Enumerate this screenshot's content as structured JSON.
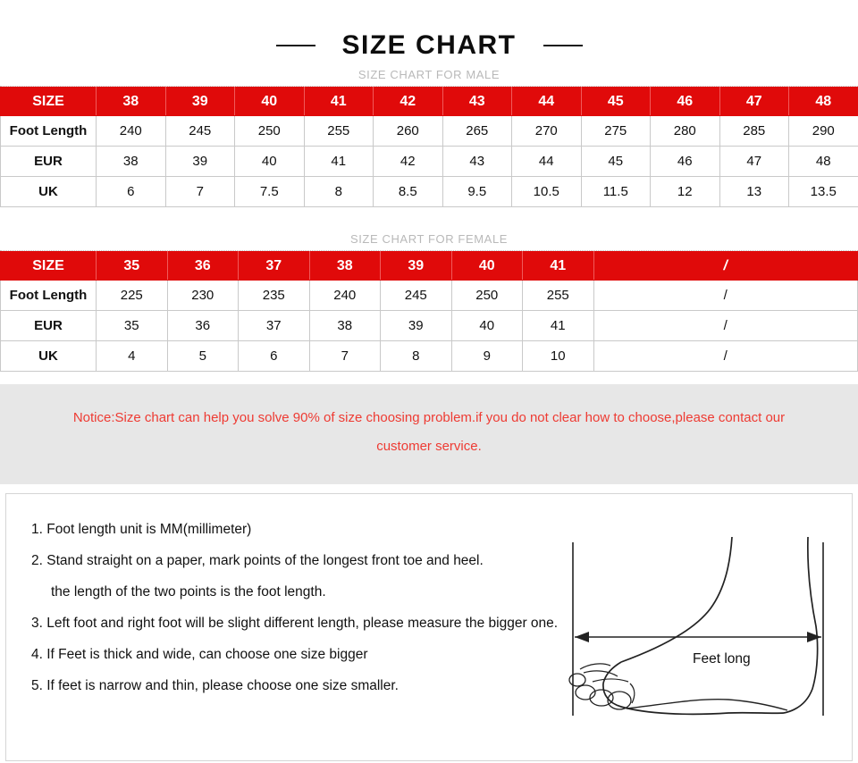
{
  "header": {
    "title": "SIZE CHART",
    "left_dash": "dash",
    "right_dash": "dash"
  },
  "male_section": {
    "caption": "SIZE CHART FOR MALE",
    "row_labels": [
      "SIZE",
      "Foot Length",
      "EUR",
      "UK"
    ],
    "sizes": [
      "38",
      "39",
      "40",
      "41",
      "42",
      "43",
      "44",
      "45",
      "46",
      "47",
      "48"
    ],
    "foot_length": [
      "240",
      "245",
      "250",
      "255",
      "260",
      "265",
      "270",
      "275",
      "280",
      "285",
      "290"
    ],
    "eur": [
      "38",
      "39",
      "40",
      "41",
      "42",
      "43",
      "44",
      "45",
      "46",
      "47",
      "48"
    ],
    "uk": [
      "6",
      "7",
      "7.5",
      "8",
      "8.5",
      "9.5",
      "10.5",
      "11.5",
      "12",
      "13",
      "13.5"
    ]
  },
  "female_section": {
    "caption": "SIZE CHART FOR FEMALE",
    "row_labels": [
      "SIZE",
      "Foot Length",
      "EUR",
      "UK"
    ],
    "sizes": [
      "35",
      "36",
      "37",
      "38",
      "39",
      "40",
      "41"
    ],
    "foot_length": [
      "225",
      "230",
      "235",
      "240",
      "245",
      "250",
      "255"
    ],
    "eur": [
      "35",
      "36",
      "37",
      "38",
      "39",
      "40",
      "41"
    ],
    "uk": [
      "4",
      "5",
      "6",
      "7",
      "8",
      "9",
      "10"
    ],
    "empty_marker": "/"
  },
  "notice": {
    "line1": "Notice:Size chart can help you solve 90% of size choosing problem.if you do not clear how to choose,please contact our",
    "line2": "customer service."
  },
  "instructions": {
    "steps": [
      "1. Foot length unit is MM(millimeter)",
      "2. Stand straight on a paper, mark points of the longest front toe and heel.",
      "the length of the two points is the foot length.",
      "3. Left foot and right foot will be slight different length, please measure the bigger one.",
      "4. If Feet is thick and wide, can choose one size bigger",
      "5. If feet is narrow and thin, please choose one size smaller."
    ]
  },
  "figure": {
    "measure_label": "Feet long"
  },
  "colors": {
    "header_red": "#e00a0a",
    "notice_red": "#ee3b33",
    "notice_bg": "#e7e7e7",
    "caption_gray": "#b9b9b9",
    "border_gray": "#c9c9c9"
  }
}
